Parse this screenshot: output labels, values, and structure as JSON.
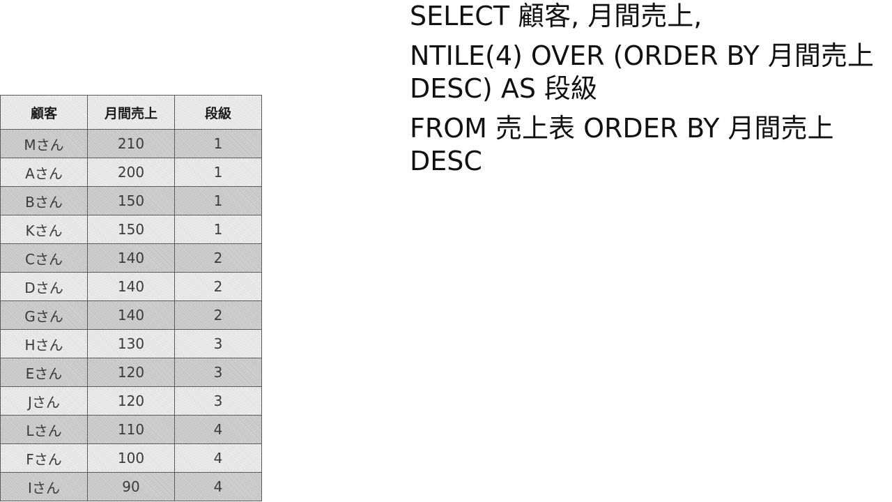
{
  "table": {
    "headers": [
      "顧客",
      "月間売上",
      "段級"
    ],
    "rows": [
      [
        "Mさん",
        "210",
        "1"
      ],
      [
        "Aさん",
        "200",
        "1"
      ],
      [
        "Bさん",
        "150",
        "1"
      ],
      [
        "Kさん",
        "150",
        "1"
      ],
      [
        "Cさん",
        "140",
        "2"
      ],
      [
        "Dさん",
        "140",
        "2"
      ],
      [
        "Gさん",
        "140",
        "2"
      ],
      [
        "Hさん",
        "130",
        "3"
      ],
      [
        "Eさん",
        "120",
        "3"
      ],
      [
        "Jさん",
        "120",
        "3"
      ],
      [
        "Lさん",
        "110",
        "4"
      ],
      [
        "Fさん",
        "100",
        "4"
      ],
      [
        "Iさん",
        "90",
        "4"
      ]
    ]
  },
  "sql": {
    "line1": "SELECT 顧客, 月間売上,",
    "line2": "NTILE(4) OVER (ORDER BY 月間売上 DESC) AS 段級",
    "line3": "FROM 売上表 ORDER BY 月間売上 DESC"
  },
  "colors": {
    "row_dark": "#cfcfcf",
    "row_light": "#ebebeb",
    "border": "#5a5a5a"
  }
}
